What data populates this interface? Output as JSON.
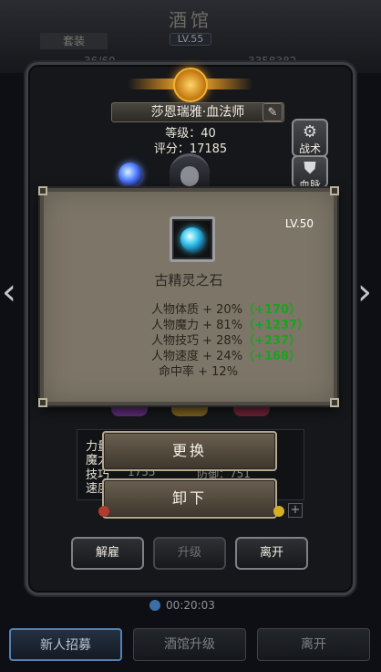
{
  "background": {
    "title": "酒馆",
    "level": "LV.55",
    "tab_label": "套装",
    "stat_left": "36/60",
    "stat_right": "3358382"
  },
  "character": {
    "name": "莎恩瑞雅·血法师",
    "level_text": "等级：40",
    "score_text": "评分：17185"
  },
  "side_buttons": [
    {
      "label": "战术",
      "icon": "gear-icon"
    },
    {
      "label": "血脉",
      "icon": "armor-icon"
    }
  ],
  "popup": {
    "level": "LV.50",
    "item_name": "古精灵之石",
    "attributes": [
      {
        "text": "人物体质 + 20%",
        "bonus": "（+170）"
      },
      {
        "text": "人物魔力 + 81%",
        "bonus": "（+1237）"
      },
      {
        "text": "人物技巧 + 28%",
        "bonus": "（+237）"
      },
      {
        "text": "人物速度 + 24%",
        "bonus": "（+168）"
      },
      {
        "text": "命中率 + 12%",
        "bonus": ""
      }
    ]
  },
  "stats": {
    "rows": [
      {
        "label": "力量",
        "value": ""
      },
      {
        "label": "魔力",
        "value": ""
      },
      {
        "label": "技巧",
        "value": "1755"
      },
      {
        "label": "速度",
        "value": ""
      }
    ],
    "row3_right": "防御：751"
  },
  "actions": {
    "replace": "更换",
    "unequip": "卸下"
  },
  "footer": {
    "dismiss": "解雇",
    "upgrade": "升级",
    "leave": "离开"
  },
  "timer": "00:20:03",
  "bottom_bar": {
    "recruit": "新人招募",
    "tavern_upgrade": "酒馆升级",
    "leave": "离开"
  },
  "colors": {
    "bonus_green": "#17a51c",
    "popup_bg": "#7d7668",
    "active_blue": "#5282b7"
  }
}
